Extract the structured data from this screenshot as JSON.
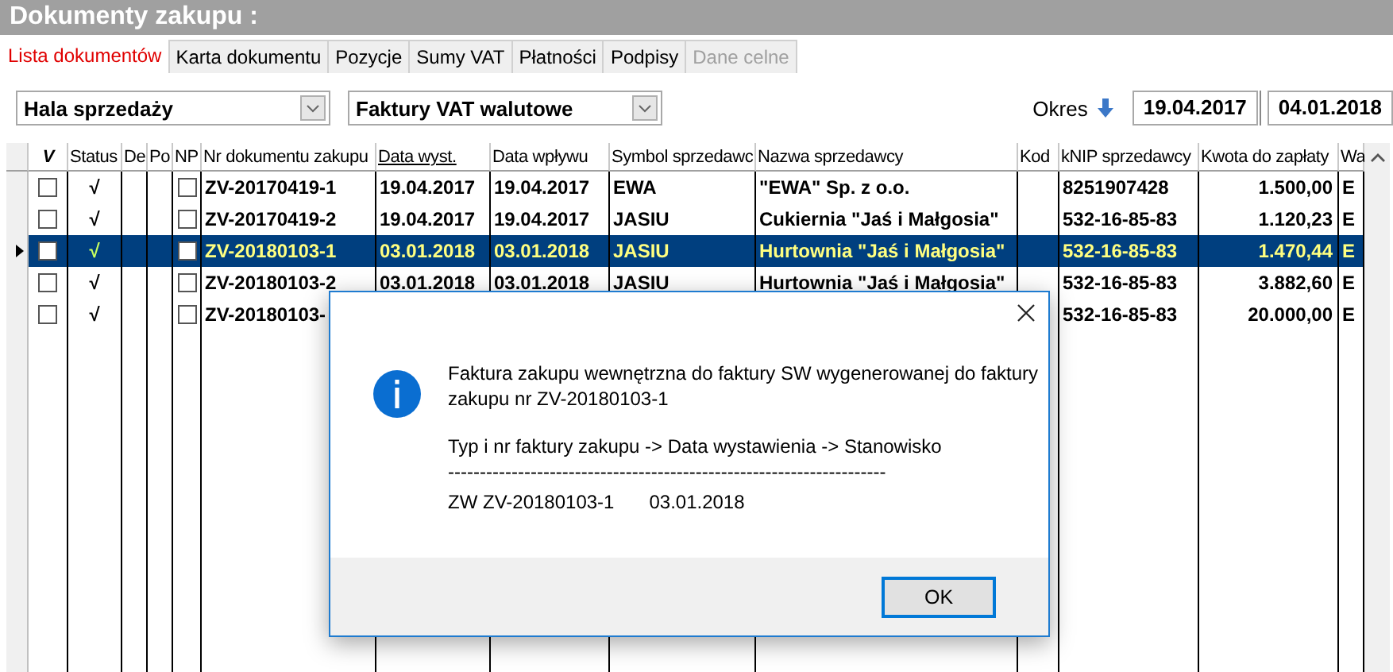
{
  "title": "Dokumenty zakupu :",
  "tabs": [
    {
      "label": "Lista dokumentów",
      "selected": true,
      "disabled": false
    },
    {
      "label": "Karta dokumentu",
      "selected": false,
      "disabled": false
    },
    {
      "label": "Pozycje",
      "selected": false,
      "disabled": false
    },
    {
      "label": "Sumy VAT",
      "selected": false,
      "disabled": false
    },
    {
      "label": "Płatności",
      "selected": false,
      "disabled": false
    },
    {
      "label": "Podpisy",
      "selected": false,
      "disabled": false
    },
    {
      "label": "Dane celne",
      "selected": false,
      "disabled": true
    }
  ],
  "filters": {
    "warehouse": {
      "value": "Hala sprzedaży"
    },
    "document_type": {
      "value": "Faktury VAT walutowe"
    },
    "period_label": "Okres",
    "date_from": "19.04.2017",
    "date_to": "04.01.2018"
  },
  "table": {
    "columns": [
      {
        "label": "V",
        "kind": "checkbox",
        "sorted": false
      },
      {
        "label": "Status",
        "kind": "mark",
        "sorted": false
      },
      {
        "label": "De",
        "kind": "blank",
        "sorted": false
      },
      {
        "label": "Po",
        "kind": "blank",
        "sorted": false
      },
      {
        "label": "NP",
        "kind": "checkbox",
        "sorted": false
      },
      {
        "label": "Nr dokumentu zakupu",
        "kind": "text",
        "sorted": false
      },
      {
        "label": "Data wyst.",
        "kind": "text",
        "sorted": true
      },
      {
        "label": "Data wpływu",
        "kind": "text",
        "sorted": false
      },
      {
        "label": "Symbol sprzedawc",
        "kind": "text",
        "sorted": false
      },
      {
        "label": "Nazwa sprzedawcy",
        "kind": "text",
        "sorted": false
      },
      {
        "label": "Kod",
        "kind": "blank",
        "sorted": false
      },
      {
        "label": "kNIP sprzedawcy",
        "kind": "text",
        "sorted": false
      },
      {
        "label": "Kwota do zapłaty",
        "kind": "number",
        "sorted": false
      },
      {
        "label": "Wa",
        "kind": "text",
        "sorted": false
      }
    ],
    "rows": [
      {
        "selected": false,
        "cells": [
          {
            "checked": false
          },
          "√",
          "",
          "",
          {
            "checked": false
          },
          "ZV-20170419-1",
          "19.04.2017",
          "19.04.2017",
          "EWA",
          "\"EWA\" Sp. z o.o.",
          "",
          "8251907428",
          "1.500,00",
          "E"
        ]
      },
      {
        "selected": false,
        "cells": [
          {
            "checked": false
          },
          "√",
          "",
          "",
          {
            "checked": false
          },
          "ZV-20170419-2",
          "19.04.2017",
          "19.04.2017",
          "JASIU",
          "Cukiernia \"Jaś i Małgosia\"",
          "",
          "532-16-85-83",
          "1.120,23",
          "E"
        ]
      },
      {
        "selected": true,
        "cells": [
          {
            "checked": false
          },
          "√",
          "",
          "",
          {
            "checked": false
          },
          "ZV-20180103-1",
          "03.01.2018",
          "03.01.2018",
          "JASIU",
          "Hurtownia \"Jaś i Małgosia\"",
          "",
          "532-16-85-83",
          "1.470,44",
          "E"
        ]
      },
      {
        "selected": false,
        "cells": [
          {
            "checked": false
          },
          "√",
          "",
          "",
          {
            "checked": false
          },
          "ZV-20180103-2",
          "03.01.2018",
          "03.01.2018",
          "JASIU",
          "Hurtownia \"Jaś i Małgosia\"",
          "",
          "532-16-85-83",
          "3.882,60",
          "E"
        ]
      },
      {
        "selected": false,
        "cells": [
          {
            "checked": false
          },
          "√",
          "",
          "",
          {
            "checked": false
          },
          "ZV-20180103-",
          "",
          "",
          "",
          "",
          "",
          "532-16-85-83",
          "20.000,00",
          "E"
        ]
      }
    ]
  },
  "dialog": {
    "message": "Faktura zakupu wewnętrzna do faktury SW wygenerowanej do faktury zakupu nr ZV-20180103-1",
    "caption": "Typ i nr faktury zakupu -> Data wystawienia -> Stanowisko",
    "separator": "---------------------------------------------------------------------",
    "entries": [
      {
        "document": "ZW ZV-20180103-1",
        "date": "03.01.2018"
      }
    ],
    "button": "OK"
  }
}
